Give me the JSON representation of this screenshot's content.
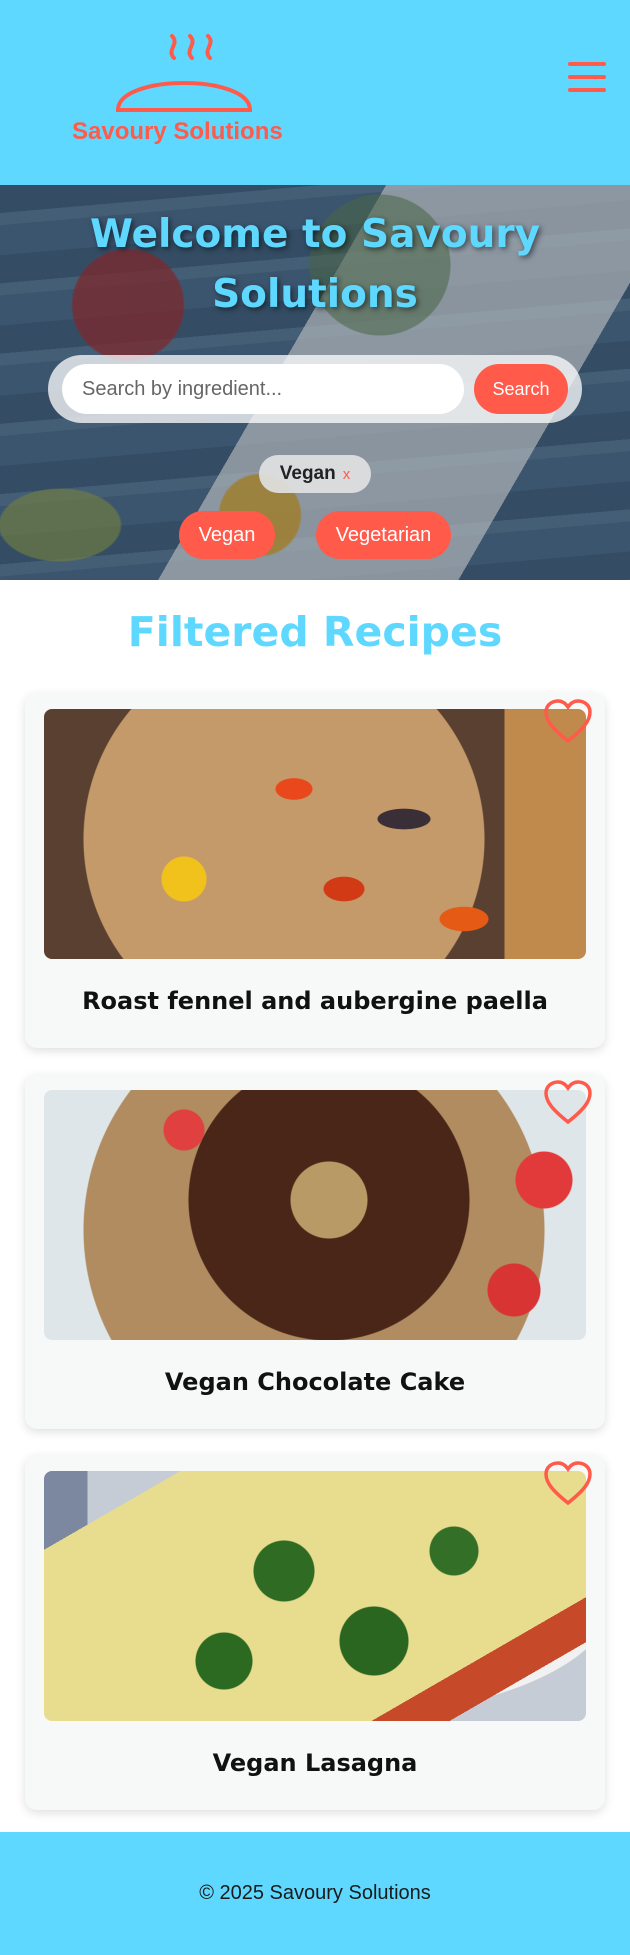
{
  "header": {
    "logo_text": "Savoury Solutions"
  },
  "hero": {
    "title": "Welcome to Savoury Solutions",
    "search": {
      "placeholder": "Search by ingredient...",
      "value": "",
      "button_label": "Search"
    },
    "active_chip": {
      "label": "Vegan",
      "remove": "x"
    },
    "filters": [
      "Vegan",
      "Vegetarian"
    ]
  },
  "main": {
    "section_title": "Filtered Recipes",
    "recipes": [
      {
        "title": "Roast fennel and aubergine paella"
      },
      {
        "title": "Vegan Chocolate Cake"
      },
      {
        "title": "Vegan Lasagna"
      }
    ]
  },
  "footer": {
    "copyright": "© 2025 Savoury Solutions"
  },
  "colors": {
    "primary": "#5ed8ff",
    "accent": "#ff5a4a"
  }
}
